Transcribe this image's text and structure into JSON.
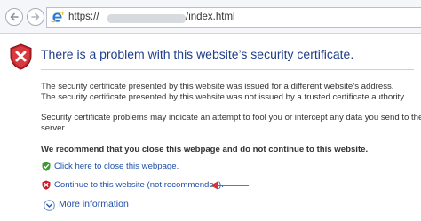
{
  "toolbar": {
    "back_icon": "back-arrow-icon",
    "forward_icon": "forward-arrow-icon",
    "address": {
      "browser_icon": "ie-logo-icon",
      "url_prefix": "https://",
      "url_hidden_part": "redacted",
      "url_suffix": "/index.html"
    }
  },
  "page": {
    "shield_icon": "red-shield-x-icon",
    "title": "There is a problem with this website’s security certificate.",
    "paragraph1_line1": "The security certificate presented by this website was issued for a different website’s address.",
    "paragraph1_line2": "The security certificate presented by this website was not issued by a trusted certificate authority.",
    "paragraph2_line1": "Security certificate problems may indicate an attempt to fool you or intercept any data you send to the",
    "paragraph2_line2": "server.",
    "recommendation": "We recommend that you close this webpage and do not continue to this website.",
    "options": {
      "close_icon": "green-shield-check-icon",
      "close_label": "Click here to close this webpage.",
      "continue_icon": "red-shield-x-icon",
      "continue_label": "Continue to this website (not recommended).",
      "annotation_icon": "red-arrow-icon"
    },
    "more": {
      "icon": "chevron-down-circle-icon",
      "label": "More information"
    }
  },
  "colors": {
    "title": "#1f3f8a",
    "link": "#1f4fa8",
    "danger": "#c8202a",
    "safe": "#3c9a2e",
    "annotation_arrow": "#d8342f"
  }
}
